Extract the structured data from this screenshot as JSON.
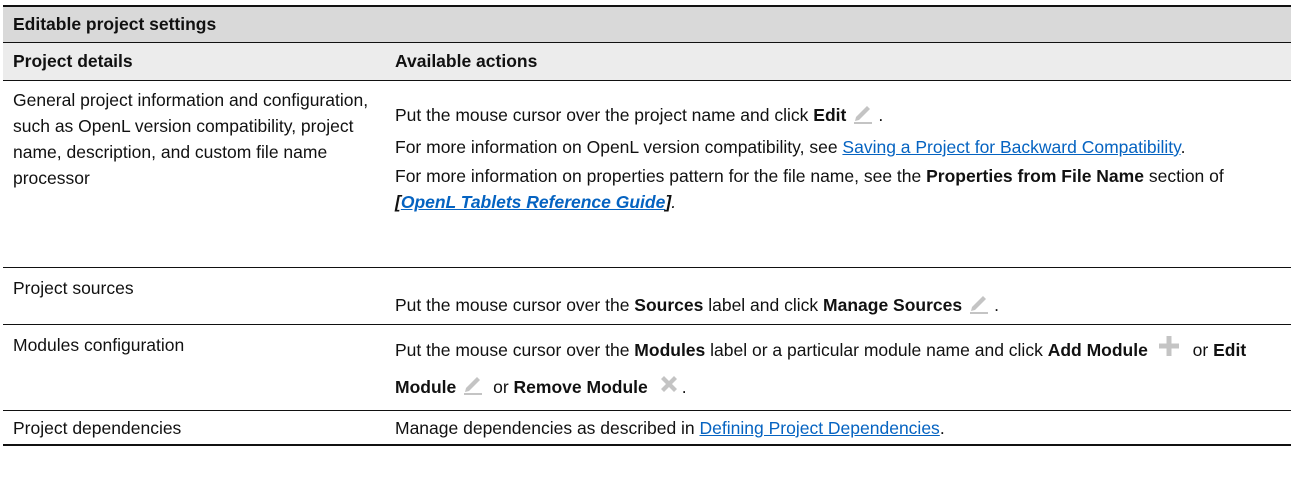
{
  "table": {
    "title": "Editable project settings",
    "col_details": "Project details",
    "col_actions": "Available actions",
    "rows": [
      {
        "details": "General project information and configuration, such as OpenL version compatibility, project name, description, and custom file name processor",
        "a1_pre": "Put the mouse cursor over the project name and click ",
        "a1_bold": "Edit",
        "a1_icon": "pencil-icon",
        "a1_post": ".",
        "a2_pre": "For more information on OpenL version compatibility, see ",
        "a2_link": "Saving a Project for Backward Compatibility",
        "a2_post": ".",
        "a3_pre": "For more information on properties pattern for the file name, see the ",
        "a3_bold": "Properties from File Name",
        "a3_mid": " section of ",
        "a3_open": "[",
        "a3_link": "OpenL Tablets Reference Guide",
        "a3_close": "]",
        "a3_post": "."
      },
      {
        "details": "Project sources",
        "a_pre": "Put the mouse cursor over the ",
        "a_bold1": "Sources",
        "a_mid": " label and click ",
        "a_bold2": "Manage Sources",
        "a_icon": "pencil-icon",
        "a_post": "."
      },
      {
        "details": "Modules configuration",
        "a_pre": "Put the mouse cursor over the ",
        "a_bold1": "Modules",
        "a_mid": " label or a particular module name and click ",
        "a_add": "Add Module",
        "add_icon": "plus-icon",
        "a_or1": " or ",
        "a_edit": "Edit Module",
        "edit_icon": "pencil-icon",
        "a_or2": " or ",
        "a_remove": "Remove Module",
        "remove_icon": "cross-icon",
        "a_post": "."
      },
      {
        "details": "Project dependencies",
        "a_pre": "Manage dependencies as described in ",
        "a_link": "Defining Project Dependencies",
        "a_post": "."
      }
    ],
    "icon_color": "#c4c4c4",
    "link_color": "#0563c1"
  }
}
